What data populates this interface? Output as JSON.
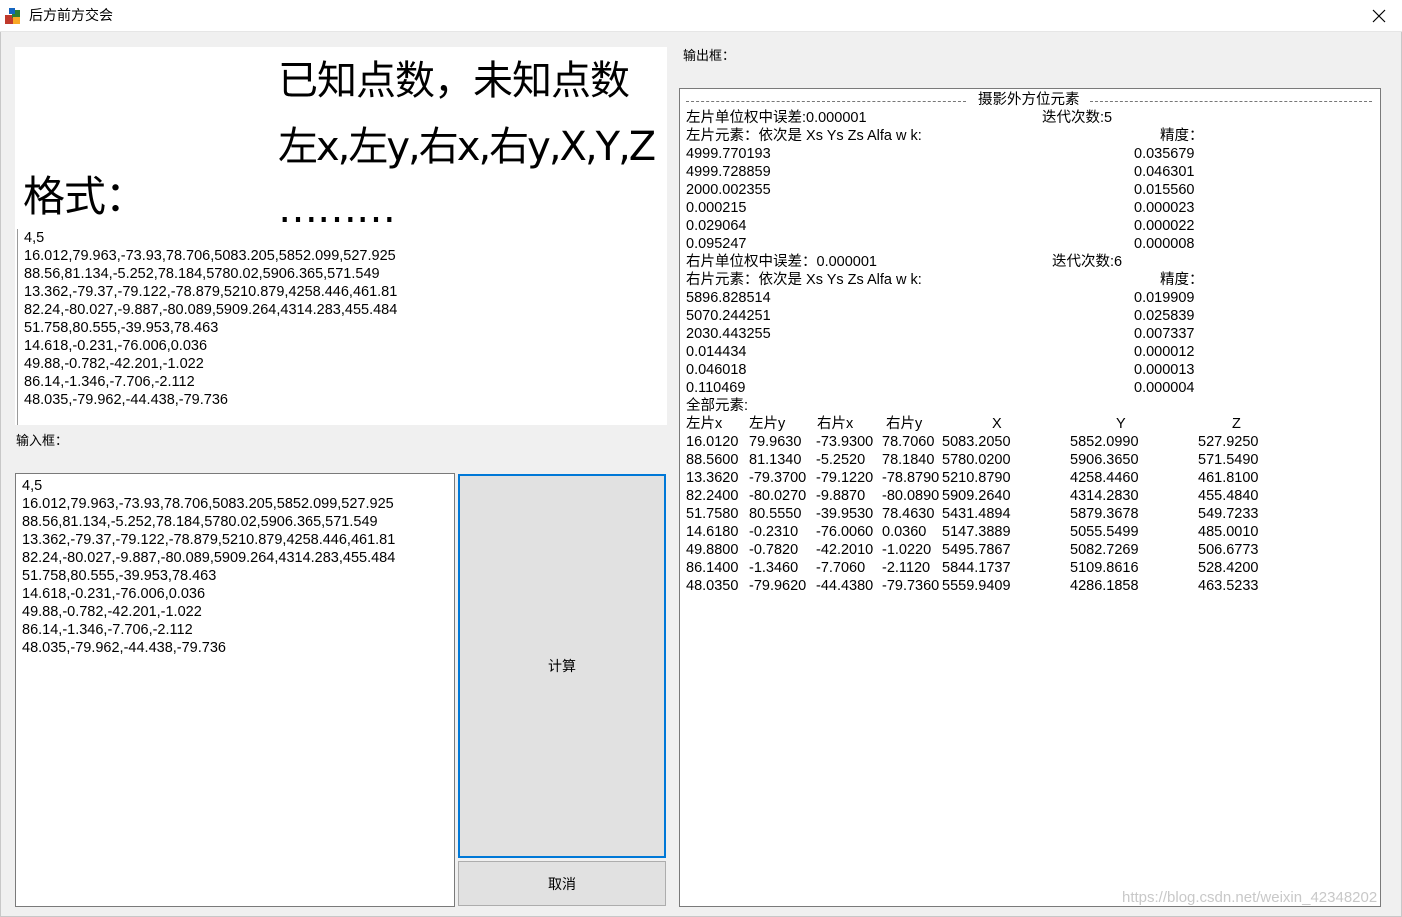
{
  "window": {
    "title": "后方前方交会"
  },
  "format_panel": {
    "line1": "已知点数，未知点数",
    "line2": "左x,左y,右x,右y,X,Y,Z",
    "line3": "………",
    "format_label": "格式：",
    "sample": "4,5\n16.012,79.963,-73.93,78.706,5083.205,5852.099,527.925\n88.56,81.134,-5.252,78.184,5780.02,5906.365,571.549\n13.362,-79.37,-79.122,-78.879,5210.879,4258.446,461.81\n82.24,-80.027,-9.887,-80.089,5909.264,4314.283,455.484\n51.758,80.555,-39.953,78.463\n14.618,-0.231,-76.006,0.036\n49.88,-0.782,-42.201,-1.022\n86.14,-1.346,-7.706,-2.112\n48.035,-79.962,-44.438,-79.736"
  },
  "input": {
    "label": "输入框：",
    "value": "4,5\n16.012,79.963,-73.93,78.706,5083.205,5852.099,527.925\n88.56,81.134,-5.252,78.184,5780.02,5906.365,571.549\n13.362,-79.37,-79.122,-78.879,5210.879,4258.446,461.81\n82.24,-80.027,-9.887,-80.089,5909.264,4314.283,455.484\n51.758,80.555,-39.953,78.463\n14.618,-0.231,-76.006,0.036\n49.88,-0.782,-42.201,-1.022\n86.14,-1.346,-7.706,-2.112\n48.035,-79.962,-44.438,-79.736"
  },
  "buttons": {
    "calculate": "计算",
    "cancel": "取消"
  },
  "output": {
    "label": "输出框：",
    "section_title": "摄影外方位元素",
    "left_error": "左片单位权中误差:0.000001",
    "left_iter": "迭代次数:5",
    "left_elems_header": "左片元素：依次是 Xs  Ys  Zs   Alfa   w   k:",
    "precision_label": "精度：",
    "left_values": [
      "4999.770193",
      "4999.728859",
      "2000.002355",
      "0.000215",
      "0.029064",
      "0.095247"
    ],
    "left_precision": [
      "0.035679",
      "0.046301",
      "0.015560",
      "0.000023",
      "0.000022",
      "0.000008"
    ],
    "right_error": "右片单位权中误差：0.000001",
    "right_iter": "迭代次数:6",
    "right_elems_header": "右片元素：依次是 Xs  Ys  Zs   Alfa   w   k:",
    "right_values": [
      "5896.828514",
      "5070.244251",
      "2030.443255",
      "0.014434",
      "0.046018",
      "0.110469"
    ],
    "right_precision": [
      "0.019909",
      "0.025839",
      "0.007337",
      "0.000012",
      "0.000013",
      "0.000004"
    ],
    "all_elems_label": "全部元素:",
    "table_headers": [
      "左片x",
      "左片y",
      "右片x",
      "右片y",
      "X",
      "Y",
      "Z"
    ],
    "table_rows": [
      [
        "16.0120",
        "79.9630",
        "-73.9300",
        "78.7060",
        "5083.2050",
        "5852.0990",
        "527.9250"
      ],
      [
        "88.5600",
        "81.1340",
        "-5.2520",
        "78.1840",
        "5780.0200",
        "5906.3650",
        "571.5490"
      ],
      [
        "13.3620",
        "-79.3700",
        "-79.1220",
        "-78.8790",
        "5210.8790",
        "4258.4460",
        "461.8100"
      ],
      [
        "82.2400",
        "-80.0270",
        "-9.8870",
        "-80.0890",
        "5909.2640",
        "4314.2830",
        "455.4840"
      ],
      [
        "51.7580",
        "80.5550",
        "-39.9530",
        "78.4630",
        "5431.4894",
        "5879.3678",
        "549.7233"
      ],
      [
        "14.6180",
        "-0.2310",
        "-76.0060",
        "0.0360",
        "5147.3889",
        "5055.5499",
        "485.0010"
      ],
      [
        "49.8800",
        "-0.7820",
        "-42.2010",
        "-1.0220",
        "5495.7867",
        "5082.7269",
        "506.6773"
      ],
      [
        "86.1400",
        "-1.3460",
        "-7.7060",
        "-2.1120",
        "5844.1737",
        "5109.8616",
        "528.4200"
      ],
      [
        "48.0350",
        "-79.9620",
        "-44.4380",
        "-79.7360",
        "5559.9409",
        "4286.1858",
        "463.5233"
      ]
    ]
  },
  "watermark": "https://blog.csdn.net/weixin_42348202"
}
